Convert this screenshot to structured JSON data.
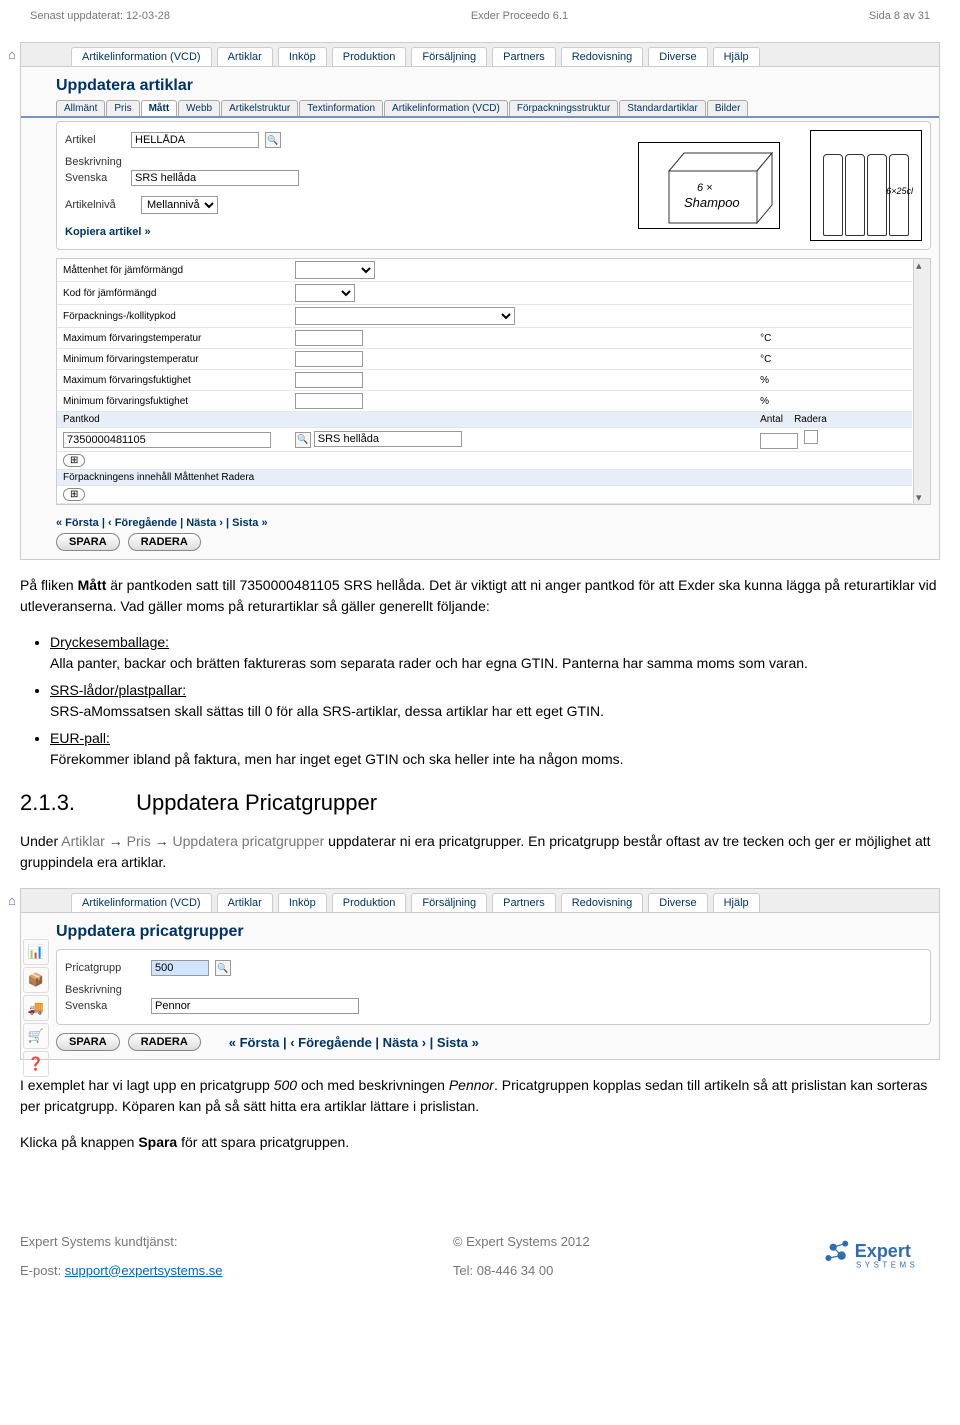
{
  "header": {
    "left": "Senast uppdaterat: 12-03-28",
    "center": "Exder Proceedo 6.1",
    "right": "Sida 8 av 31"
  },
  "screenshot1": {
    "mainTabs": [
      "Artikelinformation (VCD)",
      "Artiklar",
      "Inköp",
      "Produktion",
      "Försäljning",
      "Partners",
      "Redovisning",
      "Diverse",
      "Hjälp"
    ],
    "appTitle": "Uppdatera artiklar",
    "subTabs": [
      "Allmänt",
      "Pris",
      "Mått",
      "Webb",
      "Artikelstruktur",
      "Textinformation",
      "Artikelinformation (VCD)",
      "Förpackningsstruktur",
      "Standardartiklar",
      "Bilder"
    ],
    "activeSubTab": 2,
    "artikelLabel": "Artikel",
    "artikelValue": "HELLÅDA",
    "beskrivningLabel": "Beskrivning",
    "svenskaLabel": "Svenska",
    "svenskaValue": "SRS hellåda",
    "artikelnivaLabel": "Artikelnivå",
    "artikelnivaValue": "Mellannivå",
    "kopieraLink": "Kopiera artikel »",
    "imgBoxText": "6 ×\nShampoo",
    "imgBottleText": "6×25cl",
    "measureRows": [
      {
        "label": "Måttenhet för jämförmängd",
        "unit": ""
      },
      {
        "label": "Kod för jämförmängd",
        "unit": ""
      },
      {
        "label": "Förpacknings-/kollitypkod",
        "unit": ""
      },
      {
        "label": "Maximum förvaringstemperatur",
        "unit": "°C"
      },
      {
        "label": "Minimum förvaringstemperatur",
        "unit": "°C"
      },
      {
        "label": "Maximum förvaringsfuktighet",
        "unit": "%"
      },
      {
        "label": "Minimum förvaringsfuktighet",
        "unit": "%"
      }
    ],
    "pantkodLabel": "Pantkod",
    "antalLabel": "Antal",
    "raderaLabel": "Radera",
    "pantkodValue": "7350000481105",
    "pantkodDesc": "SRS hellåda",
    "forpackningLabel": "Förpackningens innehåll Måttenhet Radera",
    "pager": "« Första  |  ‹ Föregående  |  Nästa ›  |  Sista »",
    "spara": "SPARA",
    "radera": "RADERA"
  },
  "text1": {
    "intro": "På fliken Mått är pantkoden satt till 7350000481105 SRS hellåda. Det är viktigt att ni anger pantkod för att Exder ska kunna lägga på returartiklar vid utleveranserna. Vad gäller moms på returartiklar så gäller generellt följande:",
    "bullets": [
      {
        "head": "Dryckesemballage:",
        "body": "Alla panter, backar och brätten faktureras som separata rader och har egna GTIN. Panterna har samma moms som varan."
      },
      {
        "head": "SRS-lådor/plastpallar:",
        "body": "SRS-aMomssatsen skall sättas till 0 för alla SRS-artiklar, dessa artiklar har ett eget GTIN."
      },
      {
        "head": "EUR-pall:",
        "body": "Förekommer ibland på faktura, men har inget eget GTIN och ska heller inte ha någon moms."
      }
    ]
  },
  "section": {
    "num": "2.1.3.",
    "title": "Uppdatera Pricatgrupper",
    "navPrefix": "Under",
    "nav1": "Artiklar",
    "nav2": "Pris",
    "nav3": "Uppdatera pricatgrupper",
    "desc": "uppdaterar ni era pricatgrupper. En pricatgrupp består oftast av tre tecken och ger er möjlighet att gruppindela era artiklar."
  },
  "screenshot2": {
    "mainTabs": [
      "Artikelinformation (VCD)",
      "Artiklar",
      "Inköp",
      "Produktion",
      "Försäljning",
      "Partners",
      "Redovisning",
      "Diverse",
      "Hjälp"
    ],
    "appTitle": "Uppdatera pricatgrupper",
    "pricatgruppLabel": "Pricatgrupp",
    "pricatgruppValue": "500",
    "beskrivningLabel": "Beskrivning",
    "svenskaLabel": "Svenska",
    "svenskaValue": "Pennor",
    "spara": "SPARA",
    "radera": "RADERA",
    "pager": "« Första  |  ‹ Föregående  |  Nästa ›  |  Sista »"
  },
  "text2": {
    "p1a": "I exemplet har vi lagt upp en pricatgrupp ",
    "p1b": "500",
    "p1c": " och med beskrivningen ",
    "p1d": "Pennor",
    "p1e": ". Pricatgruppen kopplas sedan till artikeln så att prislistan kan sorteras per pricatgrupp. Köparen kan på så sätt hitta era artiklar lättare i prislistan.",
    "p2a": "Klicka på knappen ",
    "p2b": "Spara",
    "p2c": " för att spara pricatgruppen."
  },
  "footer": {
    "leftLine1": "Expert Systems kundtjänst:",
    "leftLine2Label": "E-post: ",
    "leftLine2Link": "support@expertsystems.se",
    "midLine1": "© Expert Systems 2012",
    "midLine2": "Tel: 08-446 34 00",
    "logoTop": "Expert",
    "logoBottom": "SYSTEMS"
  }
}
